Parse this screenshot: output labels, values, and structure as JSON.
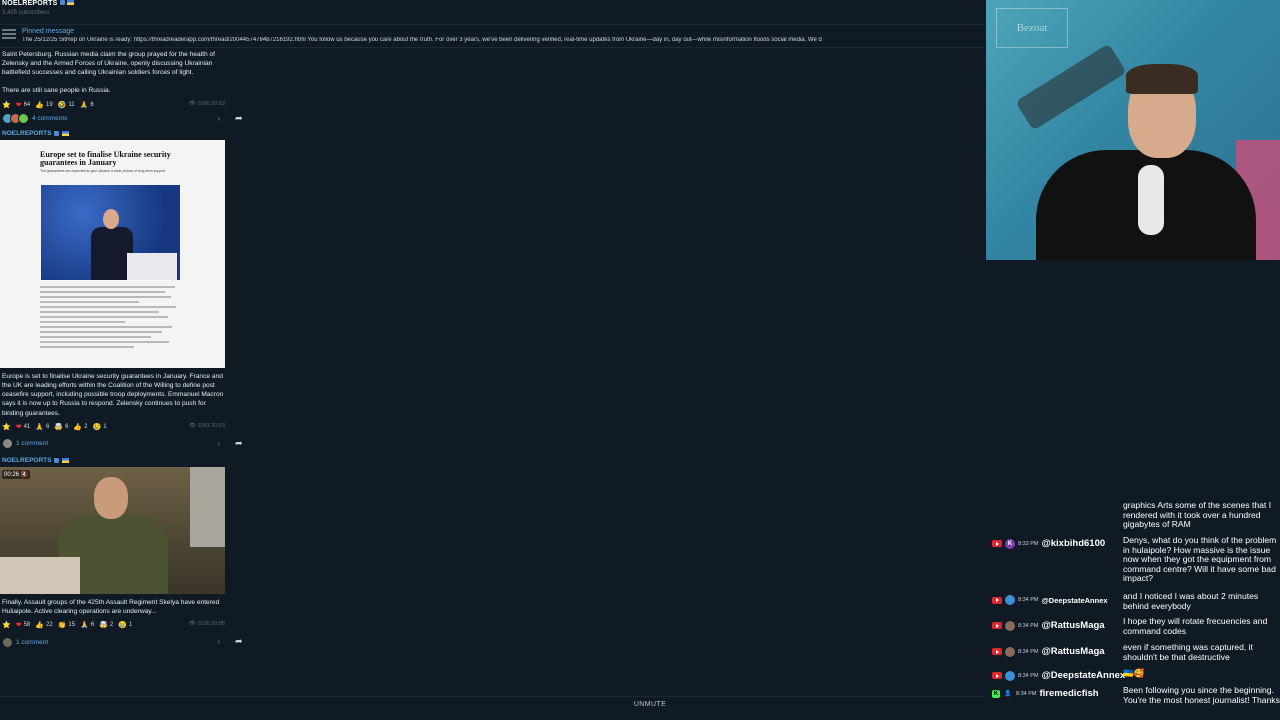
{
  "channel": {
    "name": "NOELREPORTS",
    "subscribers": "3,405 subscribers"
  },
  "pinned": {
    "label": "Pinned message",
    "text": "The 25/12/25 SitRep on Ukraine is ready: https://threadreaderapp.com/thread/2004457478487216192.html  You follow us because you care about the truth. For over 3 years, we've been delivering verified, real-time updates from Ukraine—day in, day out—while misinformation floods social media.  We d"
  },
  "posts": [
    {
      "text_lines": [
        "Saint Petersburg. Russian media claim the group prayed for the health of Zelensky and the Armed Forces of Ukraine, openly discussing Ukrainian battlefield successes and calling Ukrainian soldiers forces of light.",
        "There are still sane people in Russia."
      ],
      "reactions": [
        {
          "emoji": "⭐",
          "count": ""
        },
        {
          "emoji": "❤",
          "count": "64"
        },
        {
          "emoji": "👍",
          "count": "19"
        },
        {
          "emoji": "🤣",
          "count": "11"
        },
        {
          "emoji": "🙏",
          "count": "6"
        }
      ],
      "views": "1096",
      "time": "20:02",
      "comments": "4 comments"
    },
    {
      "author": "NOELREPORTS",
      "article": {
        "headline": "Europe set to finalise Ukraine security guarantees in January",
        "subhead": "The guarantees are expected to give Ukraine a clear picture of long-term support"
      },
      "text": "Europe is set to finalise Ukraine security guarantees in January. France and the UK are leading efforts within the Coalition of the Willing to define post ceasefire support, including possible troop deployments. Emmanuel Macron says it is now up to Russia to respond. Zelensky continues to push for binding guarantees.",
      "reactions": [
        {
          "emoji": "⭐",
          "count": ""
        },
        {
          "emoji": "❤",
          "count": "41"
        },
        {
          "emoji": "🙏",
          "count": "6"
        },
        {
          "emoji": "🤯",
          "count": "6"
        },
        {
          "emoji": "👍",
          "count": "2"
        },
        {
          "emoji": "😢",
          "count": "1"
        }
      ],
      "views": "1051",
      "time": "20:03",
      "comments": "1 comment"
    },
    {
      "author": "NOELREPORTS",
      "video_time": "00:26",
      "text": "Finally. Assault groups of the 425th Assault Regiment Skelya have entered Huliaipole. Active clearing operations are underway...",
      "reactions": [
        {
          "emoji": "⭐",
          "count": ""
        },
        {
          "emoji": "❤",
          "count": "58"
        },
        {
          "emoji": "👍",
          "count": "22"
        },
        {
          "emoji": "👏",
          "count": "15"
        },
        {
          "emoji": "🙏",
          "count": "6"
        },
        {
          "emoji": "🤯",
          "count": "2"
        },
        {
          "emoji": "😢",
          "count": "1"
        }
      ],
      "views": "1016",
      "time": "20:05",
      "comments": "1 comment"
    }
  ],
  "webcam": {
    "sign_text": "Bezoat"
  },
  "chat": [
    {
      "platform": "none",
      "time": "",
      "user": "",
      "message": "graphics Arts some of the scenes that I rendered with it took over a hundred gigabytes of RAM",
      "avatar_letter": "",
      "avatar_color": ""
    },
    {
      "platform": "youtube",
      "time": "8:33 PM",
      "user": "@kixbihd6100",
      "message": "Denys, what do you think of the problem in hulaipole? How massive is the issue now when they got the equipment from command centre? Will it have some bad impact?",
      "avatar_letter": "K",
      "avatar_color": "#7e3fb5"
    },
    {
      "platform": "youtube",
      "time": "8:34 PM",
      "user": "@DeepstateAnnex",
      "message": "and I noticed I was about 2 minutes behind everybody",
      "avatar_letter": "",
      "avatar_color": "#3f8fd6"
    },
    {
      "platform": "youtube",
      "time": "8:34 PM",
      "user": "@RattusMaga",
      "message": "I hope they will rotate frecuencies and command codes",
      "avatar_letter": "",
      "avatar_color": "#8b6a5a"
    },
    {
      "platform": "youtube",
      "time": "8:34 PM",
      "user": "@RattusMaga",
      "message": "even if something was captured, it shouldn't be that destructive",
      "avatar_letter": "",
      "avatar_color": "#8b6a5a"
    },
    {
      "platform": "youtube",
      "time": "8:34 PM",
      "user": "@DeepstateAnnex",
      "message": "🇺🇦🥰",
      "avatar_letter": "",
      "avatar_color": "#3f8fd6"
    },
    {
      "platform": "kick",
      "time": "8:34 PM",
      "user": "firemedicfish",
      "message": "Been following you since the beginning. You're the most honest journalist! Thanks",
      "avatar_letter": "",
      "avatar_color": "#555555"
    }
  ],
  "player": {
    "unmute_label": "UNMUTE"
  },
  "colors": {
    "background": "#0f1a24",
    "link": "#5fa8e0",
    "accent_live": "#e3262e",
    "kick": "#3ef04a"
  }
}
